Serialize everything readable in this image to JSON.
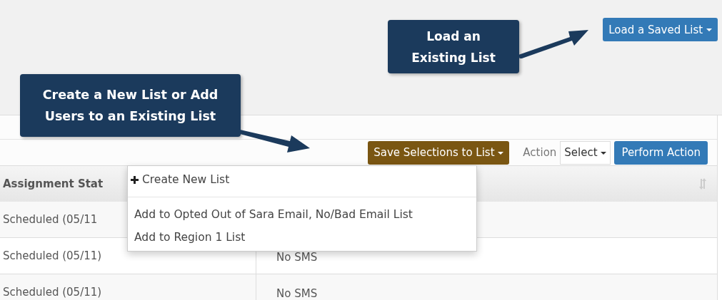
{
  "load_button": {
    "label": "Load a Saved List"
  },
  "callouts": [
    {
      "text": "Load an Existing List"
    },
    {
      "text": "Create a New List or Add Users to an Existing List"
    }
  ],
  "toolbar": {
    "save_button": {
      "label": "Save Selections to List"
    },
    "action_label": "Action",
    "action_select": {
      "value": "Select"
    },
    "perform_button": {
      "label": "Perform Action"
    }
  },
  "table": {
    "columns": [
      "Assignment Stat"
    ],
    "rows": [
      {
        "cells": [
          "Scheduled (05/11",
          ""
        ]
      },
      {
        "cells": [
          "Scheduled (05/11)",
          "No SMS"
        ]
      },
      {
        "cells": [
          "Scheduled (05/11)",
          "No SMS"
        ]
      }
    ]
  },
  "dropdown": {
    "items": [
      {
        "kind": "create",
        "label": "Create New List"
      },
      {
        "kind": "divider"
      },
      {
        "kind": "add",
        "label": "Add to Opted Out of Sara Email, No/Bad Email List"
      },
      {
        "kind": "add",
        "label": "Add to Region 1 List"
      }
    ]
  }
}
